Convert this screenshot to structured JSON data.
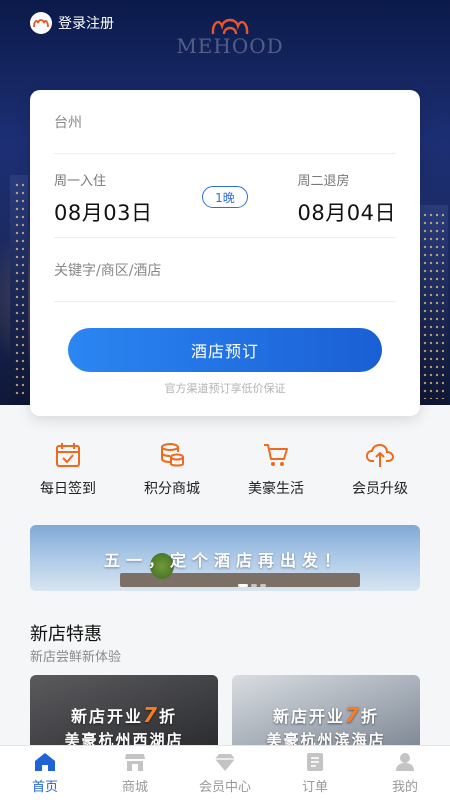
{
  "header": {
    "login_label": "登录注册",
    "brand_name": "MEHOOD"
  },
  "booking": {
    "city": "台州",
    "checkin_label": "周一入住",
    "checkin_date": "08月03日",
    "nights": "1晚",
    "checkout_label": "周二退房",
    "checkout_date": "08月04日",
    "keyword_placeholder": "关键字/商区/酒店",
    "book_button": "酒店预订",
    "note": "官方渠道预订享低价保证"
  },
  "shortcuts": [
    {
      "label": "每日签到",
      "icon": "calendar-check-icon"
    },
    {
      "label": "积分商城",
      "icon": "coins-icon"
    },
    {
      "label": "美豪生活",
      "icon": "cart-icon"
    },
    {
      "label": "会员升级",
      "icon": "cloud-upload-icon"
    }
  ],
  "banner": {
    "text": "五一，定个酒店再出发！"
  },
  "new_stores": {
    "title": "新店特惠",
    "subtitle": "新店尝鲜新体验",
    "items": [
      {
        "headline_prefix": "新店开业",
        "discount": "7",
        "headline_suffix": "折",
        "hotel": "美豪杭州西湖店"
      },
      {
        "headline_prefix": "新店开业",
        "discount": "7",
        "headline_suffix": "折",
        "hotel": "美豪杭州滨海店"
      }
    ]
  },
  "tabbar": [
    {
      "label": "首页",
      "icon": "home-icon",
      "active": true
    },
    {
      "label": "商城",
      "icon": "store-icon",
      "active": false
    },
    {
      "label": "会员中心",
      "icon": "diamond-icon",
      "active": false
    },
    {
      "label": "订单",
      "icon": "order-list-icon",
      "active": false
    },
    {
      "label": "我的",
      "icon": "person-icon",
      "active": false
    }
  ],
  "colors": {
    "accent_blue": "#1f63d6",
    "accent_orange": "#f06a1d",
    "discount_orange": "#ff7a1a"
  }
}
